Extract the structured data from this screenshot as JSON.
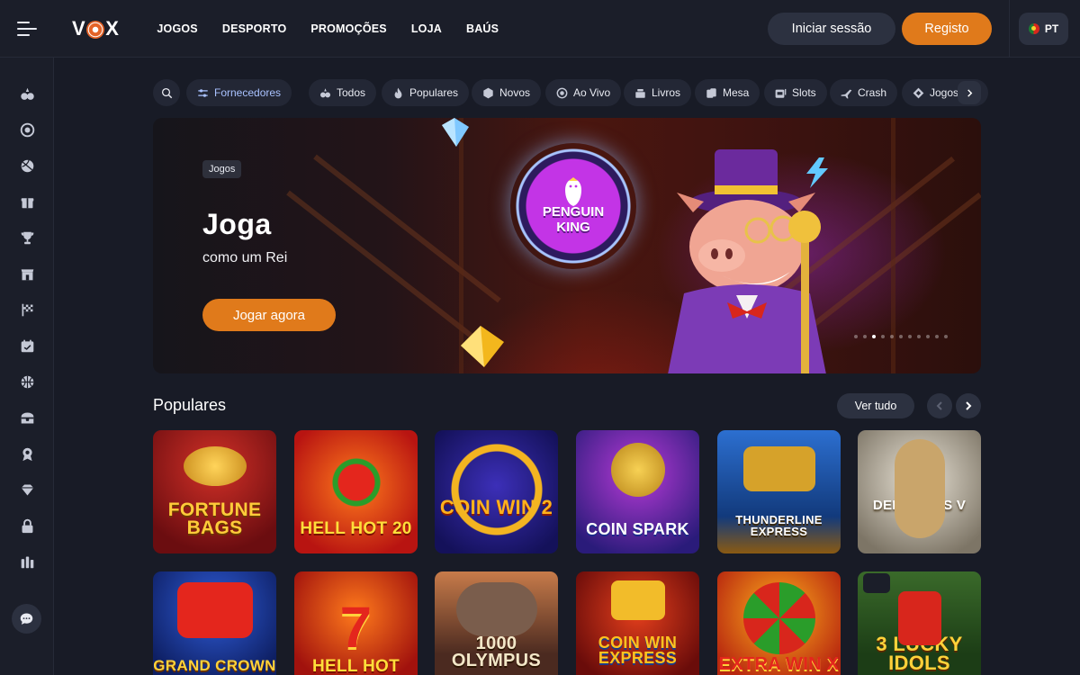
{
  "brand": {
    "logo_left": "V",
    "logo_right": "X",
    "accent": "#e07a1b"
  },
  "topnav": [
    "JOGOS",
    "DESPORTO",
    "PROMOÇÕES",
    "LOJA",
    "BAÚS"
  ],
  "auth": {
    "login": "Iniciar sessão",
    "register": "Registo"
  },
  "language": {
    "code": "PT"
  },
  "sidebar": {
    "icons": [
      "casino-icon",
      "live-icon",
      "sports-icon",
      "gift-icon",
      "trophy-icon",
      "shop-icon",
      "racing-flag-icon",
      "calendar-icon",
      "basketball-icon",
      "chest-icon",
      "award-icon",
      "diamond-icon",
      "lock-icon",
      "stats-icon"
    ],
    "chat": "chat-icon"
  },
  "filters": {
    "providers": "Fornecedores",
    "categories": [
      "Todos",
      "Populares",
      "Novos",
      "Ao Vivo",
      "Livros",
      "Mesa",
      "Slots",
      "Crash",
      "Jogos"
    ]
  },
  "banner": {
    "tag": "Jogos",
    "title": "Joga",
    "subtitle": "como um Rei",
    "cta": "Jogar agora",
    "game_logo_line1": "PENGUIN",
    "game_logo_line2": "KING",
    "slides": 11,
    "active_slide": 2
  },
  "popular": {
    "title": "Populares",
    "see_all": "Ver tudo",
    "games_row1": [
      {
        "name": "FORTUNE BAGS"
      },
      {
        "name": "HELL HOT 20"
      },
      {
        "name": "COIN WIN 2"
      },
      {
        "name": "COIN SPARK"
      },
      {
        "name": "THUNDERLINE EXPRESS"
      },
      {
        "name": "DEMI GODS V"
      }
    ],
    "games_row2": [
      {
        "name": "GRAND CROWN"
      },
      {
        "name": "HELL HOT"
      },
      {
        "name": "1000 OLYMPUS"
      },
      {
        "name": "COIN WIN EXPRESS"
      },
      {
        "name": "EXTRA WIN X"
      },
      {
        "name": "3 LUCKY IDOLS"
      }
    ]
  }
}
